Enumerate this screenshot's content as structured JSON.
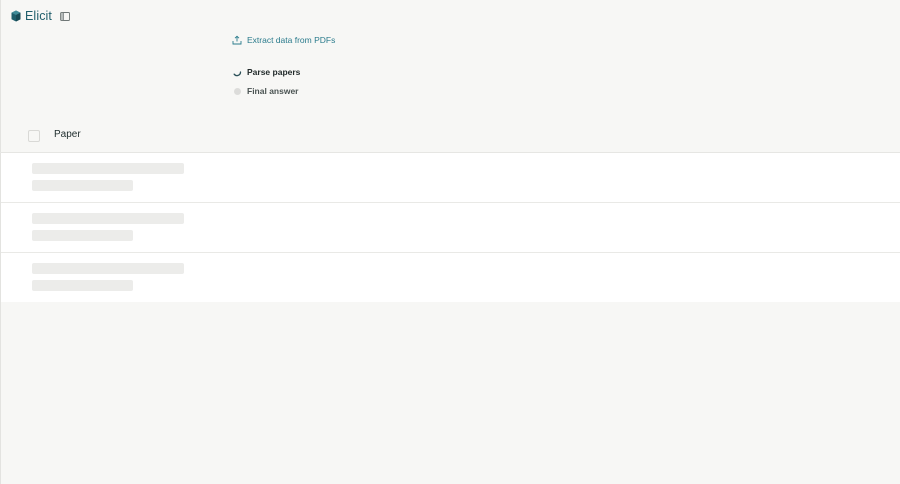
{
  "app": {
    "name": "Elicit",
    "brand_color": "#1f5e6b",
    "logo_icon": "elicit-logo-icon",
    "sidebar_toggle_icon": "sidebar-toggle-icon"
  },
  "steps": [
    {
      "label": "Extract data from PDFs",
      "icon": "upload-icon",
      "state": "link"
    },
    {
      "label": "Parse papers",
      "icon": "spinner-icon",
      "state": "in-progress"
    },
    {
      "label": "Final answer",
      "icon": "pending-dot-icon",
      "state": "pending"
    }
  ],
  "table": {
    "columns": [
      {
        "label": "Paper"
      }
    ],
    "rows_state": "loading",
    "skeleton_row_count": 3
  },
  "colors": {
    "accent": "#2a7b8c",
    "background": "#f7f7f5",
    "skeleton": "#ececea"
  }
}
